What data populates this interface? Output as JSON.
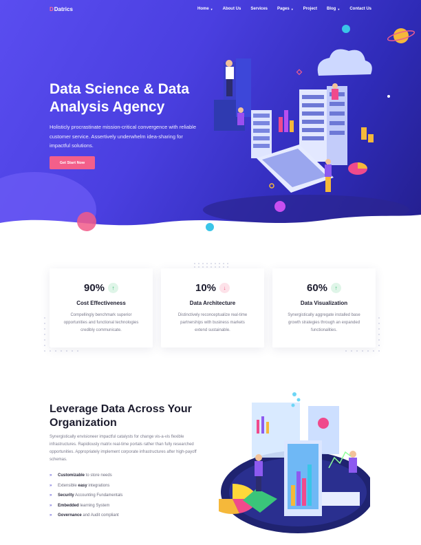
{
  "nav": {
    "logo_mark": "D",
    "logo_text": "Datrics",
    "items": [
      {
        "label": "Home",
        "has_caret": true
      },
      {
        "label": "About Us",
        "has_caret": false
      },
      {
        "label": "Services",
        "has_caret": false
      },
      {
        "label": "Pages",
        "has_caret": true
      },
      {
        "label": "Project",
        "has_caret": false
      },
      {
        "label": "Blog",
        "has_caret": true
      },
      {
        "label": "Contact Us",
        "has_caret": false
      }
    ]
  },
  "hero": {
    "title": "Data Science & Data Analysis Agency",
    "description": "Holisticly procrastinate mission-critical convergence with reliable customer service. Assertively underwhelm idea-sharing for impactful solutions.",
    "button_label": "Get Start Now"
  },
  "stats": [
    {
      "value": "90%",
      "trend": "up",
      "trend_icon": "↑",
      "title": "Cost Effectiveness",
      "description": "Compellingly benchmark superior opportunities and functional technologies credibly communicate."
    },
    {
      "value": "10%",
      "trend": "down",
      "trend_icon": "↓",
      "title": "Data Architecture",
      "description": "Distinctively reconceptualize real-time partnerships with business markets extend sustainable."
    },
    {
      "value": "60%",
      "trend": "up",
      "trend_icon": "↑",
      "title": "Data Visualization",
      "description": "Synergistically aggregate installed base growth strategies through an expanded functionalities."
    }
  ],
  "feature": {
    "title": "Leverage Data Across Your Organization",
    "description": "Synergistically envisioneer impactful catalysts for change vis-a-vis flexible infrastructures. Rapidiously matrix real-time portals rather than fully researched opportunities. Appropriately implement corporate infrastructures after high-payoff schemas.",
    "list": [
      {
        "bold": "Customizable",
        "pre": "",
        "post": " to store needs"
      },
      {
        "bold": "easy",
        "pre": "Extensible ",
        "post": " integrations"
      },
      {
        "bold": "Security",
        "pre": "",
        "post": " Accounting Fundamentals"
      },
      {
        "bold": "Embedded",
        "pre": "",
        "post": " learning System"
      },
      {
        "bold": "Governance",
        "pre": "",
        "post": " and Audit compliant"
      }
    ]
  },
  "colors": {
    "hero_start": "#5a4df0",
    "hero_end": "#241f8e",
    "accent_pink": "#f35f8a",
    "trend_up": "#2fb86b",
    "trend_down": "#f0577f"
  },
  "icons": [
    "chevron-down-icon",
    "arrow-up-icon",
    "arrow-down-icon",
    "double-chevron-icon"
  ]
}
